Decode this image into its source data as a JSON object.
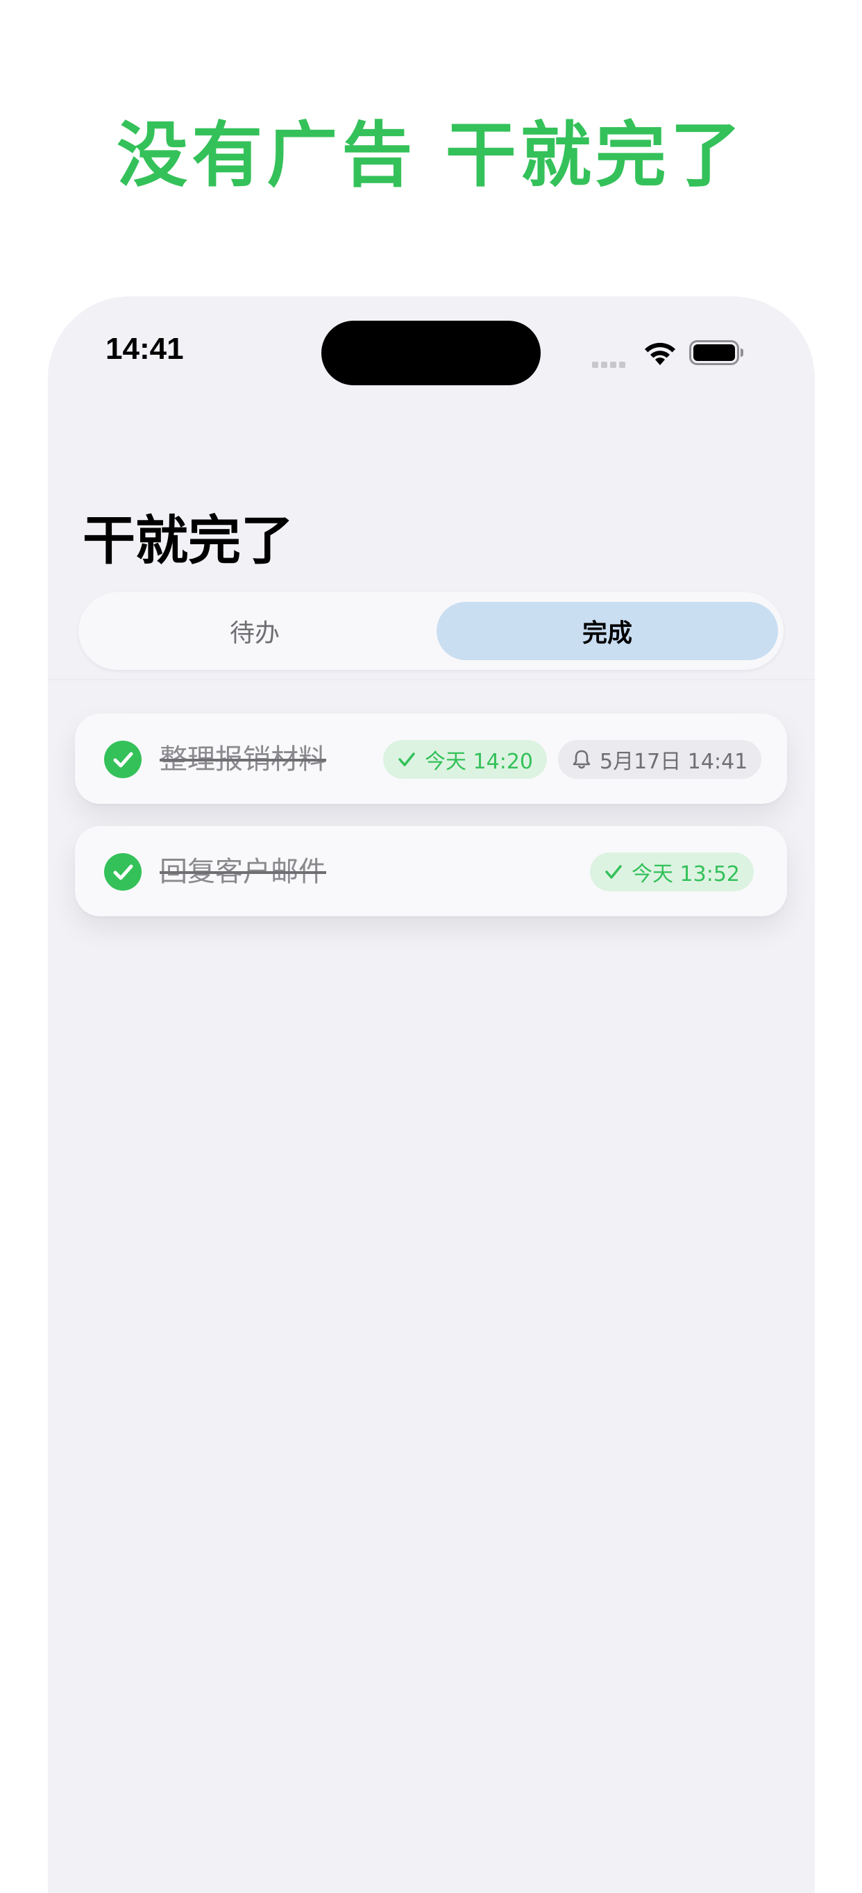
{
  "headline": "没有广告 干就完了",
  "status_bar": {
    "time": "14:41"
  },
  "app": {
    "title": "干就完了",
    "tabs": [
      {
        "label": "待办",
        "selected": false
      },
      {
        "label": "完成",
        "selected": true
      }
    ]
  },
  "tasks": [
    {
      "title": "整理报销材料",
      "completed": true,
      "completed_at": "今天 14:20",
      "reminder": "5月17日 14:41"
    },
    {
      "title": "回复客户邮件",
      "completed": true,
      "completed_at": "今天 13:52"
    }
  ],
  "colors": {
    "accent_green": "#34c159",
    "selected_tab": "#cadef2",
    "background": "#f1f1f6"
  },
  "icons": [
    "wifi-icon",
    "battery-icon",
    "check-icon",
    "bell-icon"
  ]
}
